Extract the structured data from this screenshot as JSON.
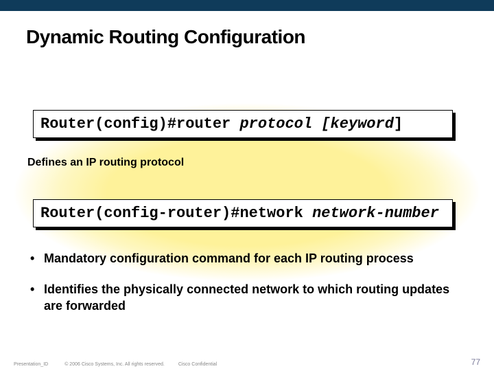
{
  "title": "Dynamic Routing Configuration",
  "codebox1": {
    "prompt": "Router(config)#",
    "cmd": "router ",
    "arg1": "protocol",
    "bracket_open": " [",
    "arg2": "keyword",
    "bracket_close": "]"
  },
  "caption1": "Defines an IP routing protocol",
  "codebox2": {
    "prompt": "Router(config-router)#",
    "cmd": "network ",
    "arg": "network-number"
  },
  "bullets": [
    "Mandatory configuration command for each IP routing process",
    "Identifies the physically connected network to which routing updates are forwarded"
  ],
  "footer": {
    "presentation_id": "Presentation_ID",
    "copyright": "© 2006 Cisco Systems, Inc. All rights reserved.",
    "confidential": "Cisco Confidential",
    "page": "77"
  }
}
